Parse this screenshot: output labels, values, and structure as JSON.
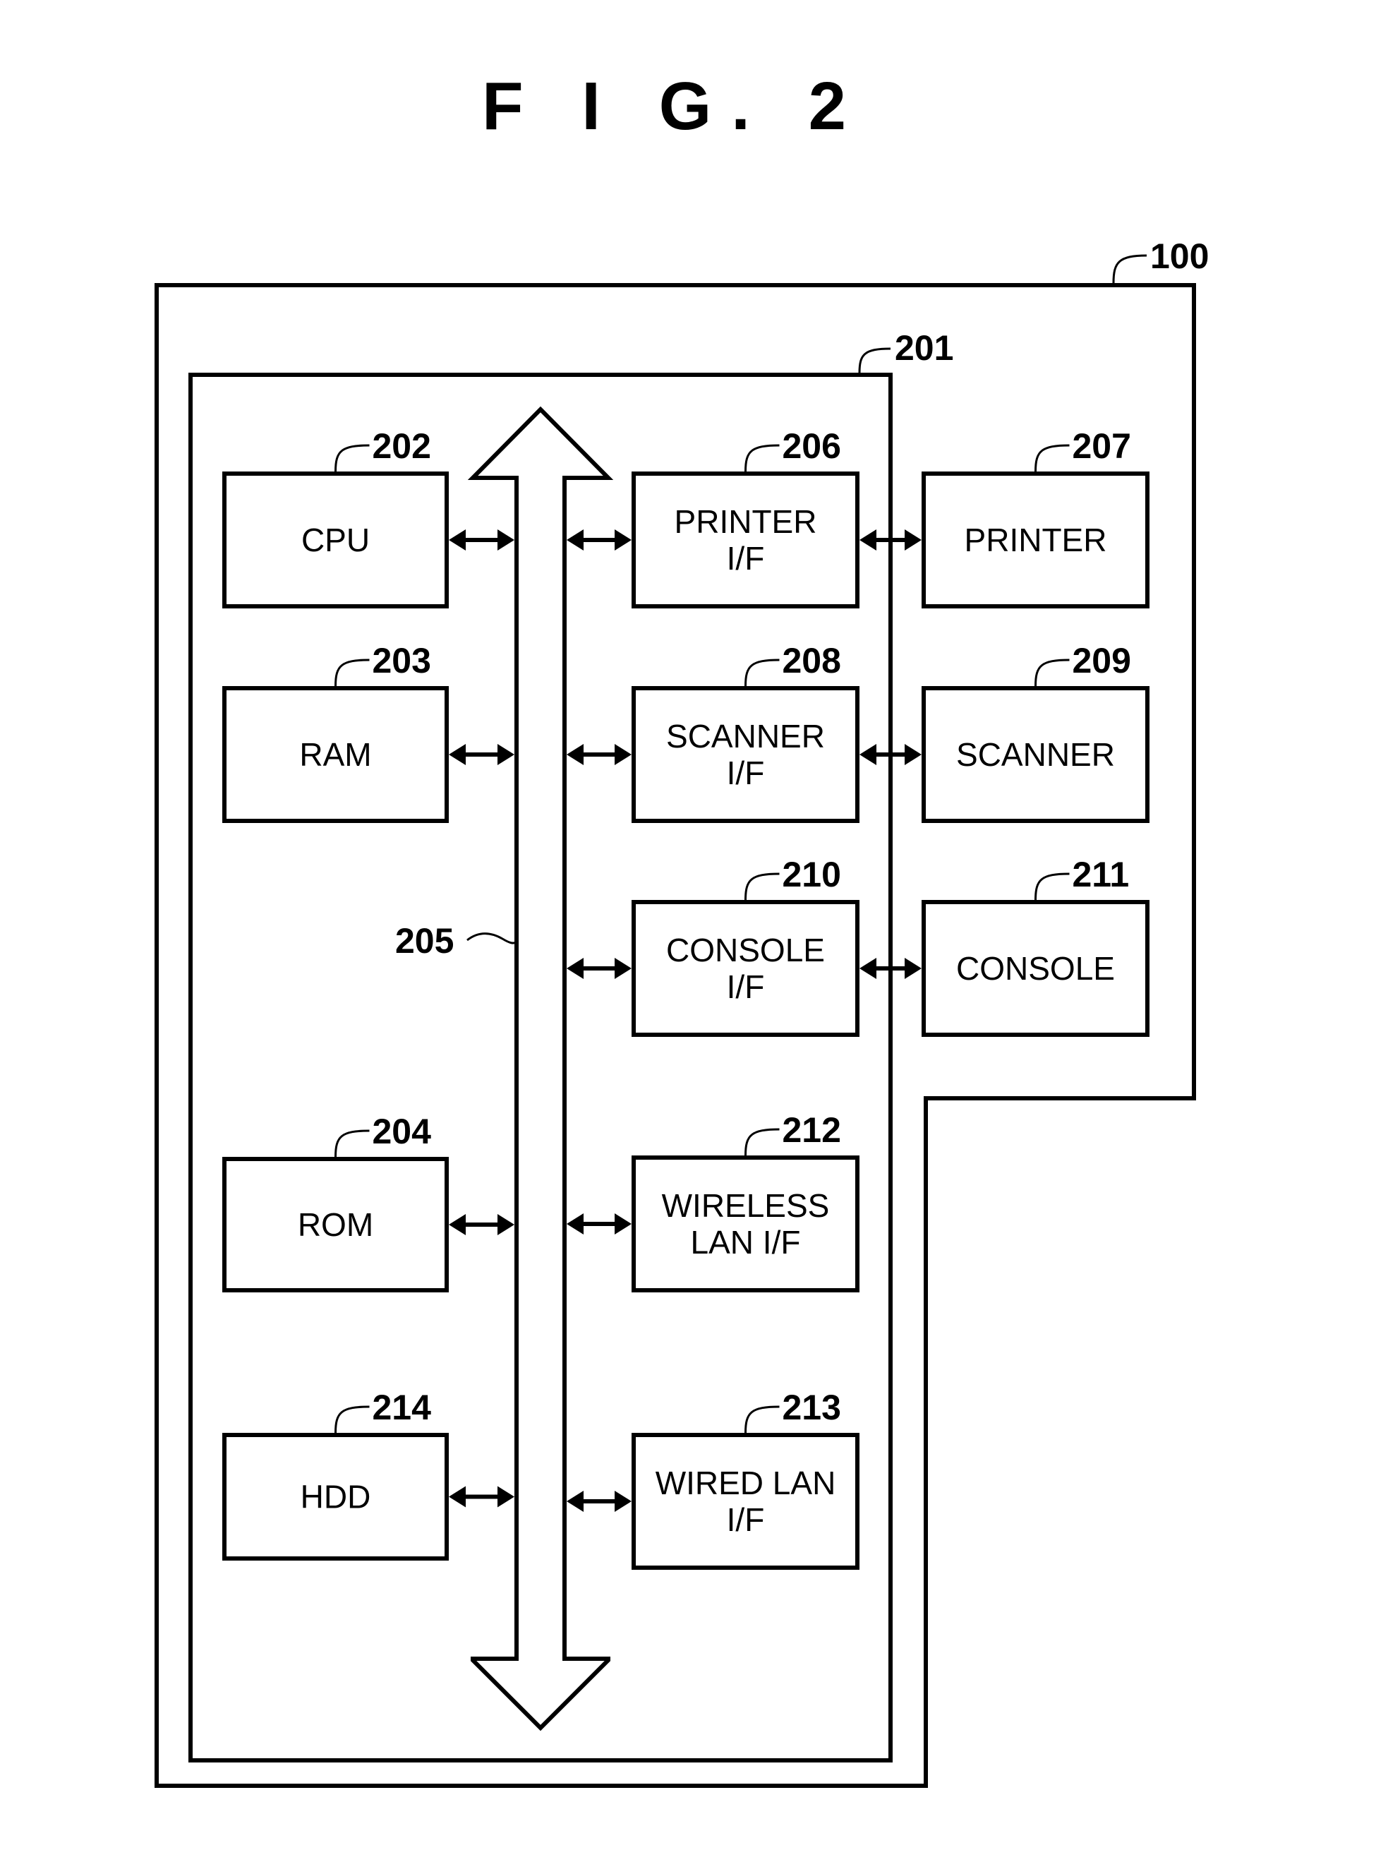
{
  "figure": {
    "title": "F I G. 2",
    "colors": {
      "stroke": "#000000",
      "background": "#ffffff"
    }
  },
  "enclosures": {
    "device": {
      "ref": "100",
      "description": "outer apparatus enclosure"
    },
    "controller": {
      "ref": "201",
      "description": "controller unit"
    },
    "bus": {
      "ref": "205",
      "description": "system bus (bidirectional)"
    }
  },
  "blocks": [
    {
      "id": "cpu",
      "ref": "202",
      "lines": [
        "CPU"
      ]
    },
    {
      "id": "ram",
      "ref": "203",
      "lines": [
        "RAM"
      ]
    },
    {
      "id": "rom",
      "ref": "204",
      "lines": [
        "ROM"
      ]
    },
    {
      "id": "hdd",
      "ref": "214",
      "lines": [
        "HDD"
      ]
    },
    {
      "id": "printer-if",
      "ref": "206",
      "lines": [
        "PRINTER",
        "I/F"
      ]
    },
    {
      "id": "scanner-if",
      "ref": "208",
      "lines": [
        "SCANNER",
        "I/F"
      ]
    },
    {
      "id": "console-if",
      "ref": "210",
      "lines": [
        "CONSOLE",
        "I/F"
      ]
    },
    {
      "id": "wireless-lan-if",
      "ref": "212",
      "lines": [
        "WIRELESS",
        "LAN I/F"
      ]
    },
    {
      "id": "wired-lan-if",
      "ref": "213",
      "lines": [
        "WIRED LAN",
        "I/F"
      ]
    },
    {
      "id": "printer",
      "ref": "207",
      "lines": [
        "PRINTER"
      ]
    },
    {
      "id": "scanner",
      "ref": "209",
      "lines": [
        "SCANNER"
      ]
    },
    {
      "id": "console",
      "ref": "211",
      "lines": [
        "CONSOLE"
      ]
    }
  ],
  "connections": [
    {
      "from": "cpu",
      "to": "bus"
    },
    {
      "from": "ram",
      "to": "bus"
    },
    {
      "from": "rom",
      "to": "bus"
    },
    {
      "from": "hdd",
      "to": "bus"
    },
    {
      "from": "bus",
      "to": "printer-if"
    },
    {
      "from": "bus",
      "to": "scanner-if"
    },
    {
      "from": "bus",
      "to": "console-if"
    },
    {
      "from": "bus",
      "to": "wireless-lan-if"
    },
    {
      "from": "bus",
      "to": "wired-lan-if"
    },
    {
      "from": "printer-if",
      "to": "printer"
    },
    {
      "from": "scanner-if",
      "to": "scanner"
    },
    {
      "from": "console-if",
      "to": "console"
    }
  ]
}
